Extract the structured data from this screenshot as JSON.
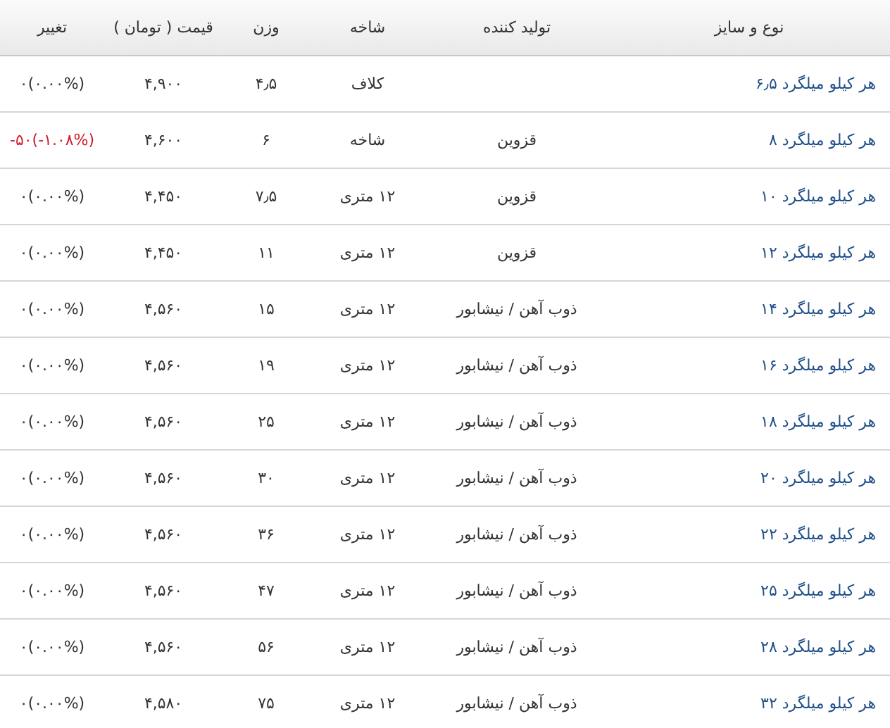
{
  "table": {
    "columns": [
      "نوع و سایز",
      "تولید کننده",
      "شاخه",
      "وزن",
      "قیمت ( تومان )",
      "تغییر"
    ],
    "rows": [
      {
        "name": "هر کیلو میلگرد ۶٫۵",
        "producer": "",
        "branch": "کلاف",
        "weight": "۴٫۵",
        "price": "۴,۹۰۰",
        "change": "۰(۰.۰۰%)",
        "negative": false
      },
      {
        "name": "هر کیلو میلگرد ۸",
        "producer": "قزوین",
        "branch": "شاخه",
        "weight": "۶",
        "price": "۴,۶۰۰",
        "change": "-۵۰(-۱.۰۸%)",
        "negative": true
      },
      {
        "name": "هر کیلو میلگرد ۱۰",
        "producer": "قزوین",
        "branch": "۱۲ متری",
        "weight": "۷٫۵",
        "price": "۴,۴۵۰",
        "change": "۰(۰.۰۰%)",
        "negative": false
      },
      {
        "name": "هر کیلو میلگرد ۱۲",
        "producer": "قزوین",
        "branch": "۱۲ متری",
        "weight": "۱۱",
        "price": "۴,۴۵۰",
        "change": "۰(۰.۰۰%)",
        "negative": false
      },
      {
        "name": "هر کیلو میلگرد ۱۴",
        "producer": "ذوب آهن / نیشابور",
        "branch": "۱۲ متری",
        "weight": "۱۵",
        "price": "۴,۵۶۰",
        "change": "۰(۰.۰۰%)",
        "negative": false
      },
      {
        "name": "هر کیلو میلگرد ۱۶",
        "producer": "ذوب آهن / نیشابور",
        "branch": "۱۲ متری",
        "weight": "۱۹",
        "price": "۴,۵۶۰",
        "change": "۰(۰.۰۰%)",
        "negative": false
      },
      {
        "name": "هر کیلو میلگرد ۱۸",
        "producer": "ذوب آهن / نیشابور",
        "branch": "۱۲ متری",
        "weight": "۲۵",
        "price": "۴,۵۶۰",
        "change": "۰(۰.۰۰%)",
        "negative": false
      },
      {
        "name": "هر کیلو میلگرد ۲۰",
        "producer": "ذوب آهن / نیشابور",
        "branch": "۱۲ متری",
        "weight": "۳۰",
        "price": "۴,۵۶۰",
        "change": "۰(۰.۰۰%)",
        "negative": false
      },
      {
        "name": "هر کیلو میلگرد ۲۲",
        "producer": "ذوب آهن / نیشابور",
        "branch": "۱۲ متری",
        "weight": "۳۶",
        "price": "۴,۵۶۰",
        "change": "۰(۰.۰۰%)",
        "negative": false
      },
      {
        "name": "هر کیلو میلگرد ۲۵",
        "producer": "ذوب آهن / نیشابور",
        "branch": "۱۲ متری",
        "weight": "۴۷",
        "price": "۴,۵۶۰",
        "change": "۰(۰.۰۰%)",
        "negative": false
      },
      {
        "name": "هر کیلو میلگرد ۲۸",
        "producer": "ذوب آهن / نیشابور",
        "branch": "۱۲ متری",
        "weight": "۵۶",
        "price": "۴,۵۶۰",
        "change": "۰(۰.۰۰%)",
        "negative": false
      },
      {
        "name": "هر کیلو میلگرد ۳۲",
        "producer": "ذوب آهن / نیشابور",
        "branch": "۱۲ متری",
        "weight": "۷۵",
        "price": "۴,۵۸۰",
        "change": "۰(۰.۰۰%)",
        "negative": false
      }
    ]
  }
}
